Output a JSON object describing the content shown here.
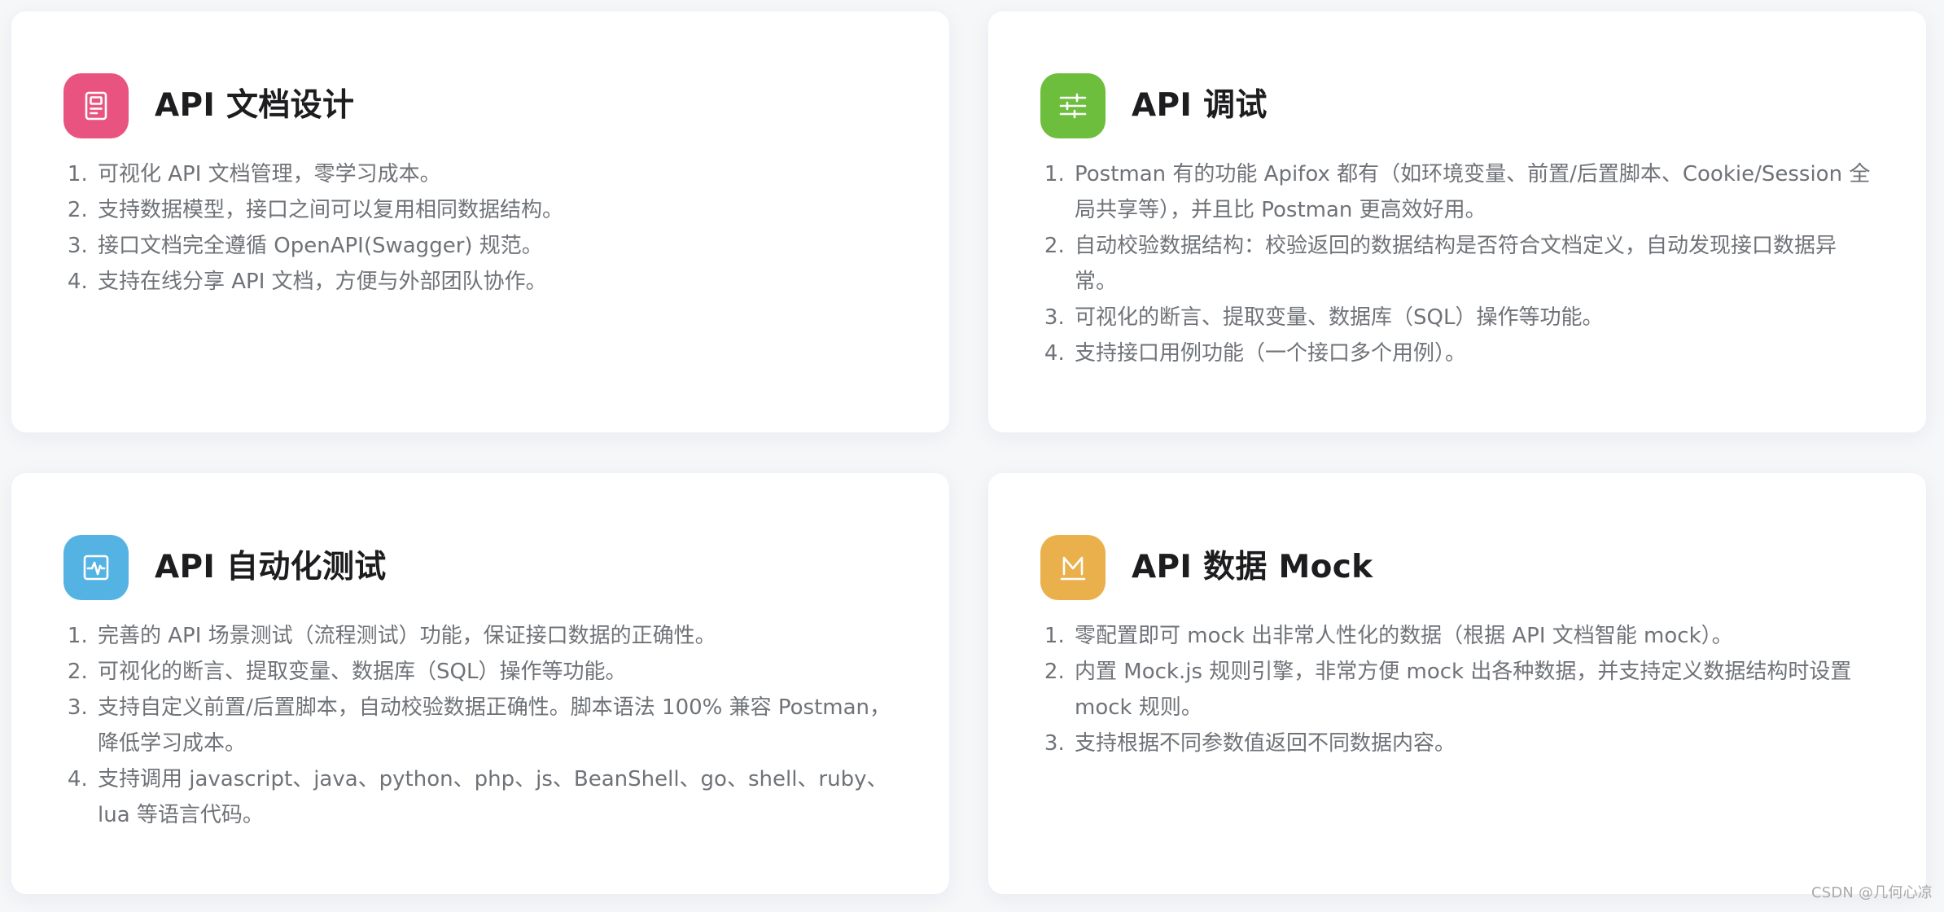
{
  "cards": [
    {
      "title": "API 文档设计",
      "icon": "document-icon",
      "color": "#e8547f",
      "items": [
        "可视化 API 文档管理，零学习成本。",
        "支持数据模型，接口之间可以复用相同数据结构。",
        "接口文档完全遵循 OpenAPI(Swagger) 规范。",
        "支持在线分享 API 文档，方便与外部团队协作。"
      ]
    },
    {
      "title": "API 调试",
      "icon": "sliders-icon",
      "color": "#6cbe3c",
      "items": [
        "Postman 有的功能 Apifox 都有（如环境变量、前置/后置脚本、Cookie/Session 全局共享等），并且比 Postman 更高效好用。",
        "自动校验数据结构：校验返回的数据结构是否符合文档定义，自动发现接口数据异常。",
        "可视化的断言、提取变量、数据库（SQL）操作等功能。",
        "支持接口用例功能（一个接口多个用例）。"
      ]
    },
    {
      "title": "API 自动化测试",
      "icon": "pulse-icon",
      "color": "#55b3e3",
      "items": [
        "完善的 API 场景测试（流程测试）功能，保证接口数据的正确性。",
        "可视化的断言、提取变量、数据库（SQL）操作等功能。",
        "支持自定义前置/后置脚本，自动校验数据正确性。脚本语法 100% 兼容 Postman，降低学习成本。",
        "支持调用 javascript、java、python、php、js、BeanShell、go、shell、ruby、lua 等语言代码。"
      ]
    },
    {
      "title": "API 数据 Mock",
      "icon": "mock-m-icon",
      "color": "#eab04b",
      "items": [
        "零配置即可 mock 出非常人性化的数据（根据 API 文档智能 mock）。",
        "内置 Mock.js 规则引擎，非常方便 mock 出各种数据，并支持定义数据结构时设置 mock 规则。",
        "支持根据不同参数值返回不同数据内容。"
      ]
    }
  ],
  "watermark": "CSDN @几何心凉"
}
